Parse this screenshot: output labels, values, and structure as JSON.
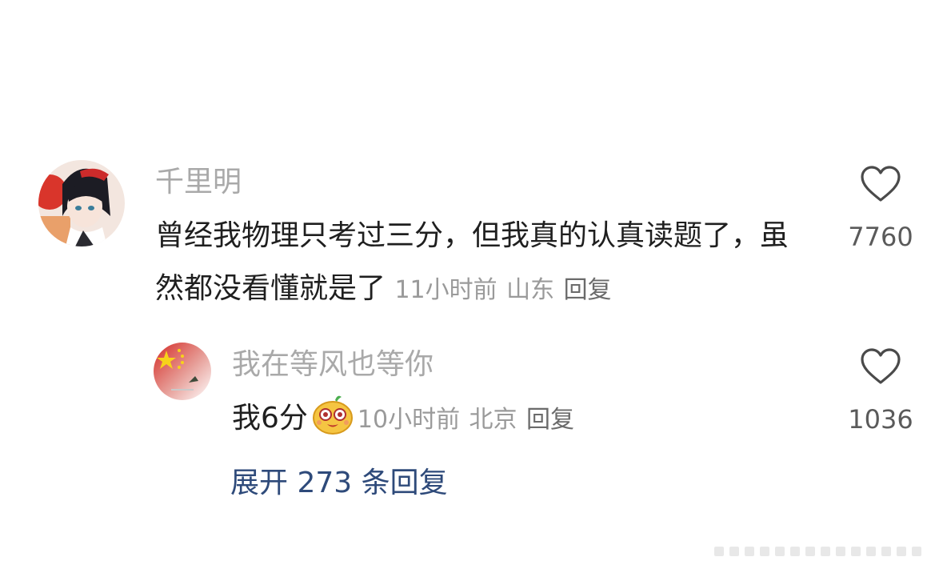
{
  "comment": {
    "username": "千里明",
    "text": "曾经我物理只考过三分，但我真的认真读题了，虽然都没看懂就是了",
    "time": "11小时前",
    "location": "山东",
    "reply_label": "回复",
    "like_count": "7760",
    "avatar_icon": "anime-character-avatar"
  },
  "reply": {
    "username": "我在等风也等你",
    "text": "我6分",
    "emoji_icon": "cute-face-emoji",
    "time": "10小时前",
    "location": "北京",
    "reply_label": "回复",
    "like_count": "1036",
    "avatar_icon": "flag-avatar"
  },
  "expand_label": "展开 273 条回复",
  "colors": {
    "username": "#a9a9a9",
    "text": "#1f1f1f",
    "meta": "#9a9a9a",
    "link": "#2e4a7a"
  }
}
